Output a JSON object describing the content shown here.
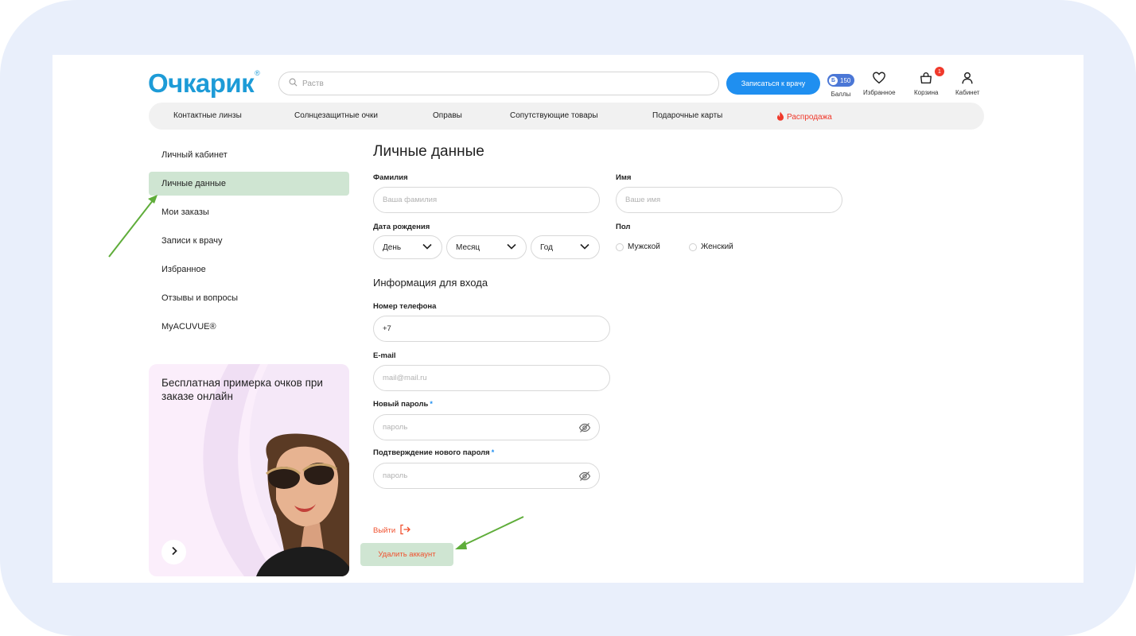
{
  "header": {
    "logo": "Очкарик",
    "logo_mark": "®",
    "search_placeholder": "Раств",
    "doctor_button": "Записаться к врачу",
    "points_value": "150",
    "points_label": "Баллы",
    "favorites_label": "Избранное",
    "cart_label": "Корзина",
    "cart_count": "1",
    "cabinet_label": "Кабинет"
  },
  "nav": {
    "items": [
      "Контактные линзы",
      "Солнцезащитные очки",
      "Оправы",
      "Сопутствующие товары",
      "Подарочные карты"
    ],
    "sale": "Распродажа",
    "sale_color": "#f0392b"
  },
  "sidebar": {
    "items": [
      "Личный кабинет",
      "Личные данные",
      "Мои заказы",
      "Записи к врачу",
      "Избранное",
      "Отзывы и вопросы",
      "MyACUVUE®"
    ],
    "active_index": 1
  },
  "promo": {
    "text": "Бесплатная примерка очков при заказе онлайн"
  },
  "form": {
    "title": "Личные данные",
    "surname_label": "Фамилия",
    "surname_placeholder": "Ваша фамилия",
    "name_label": "Имя",
    "name_placeholder": "Ваше имя",
    "birth_label": "Дата рождения",
    "day": "День",
    "month": "Месяц",
    "year": "Год",
    "gender_label": "Пол",
    "male": "Мужской",
    "female": "Женский",
    "login_section": "Информация для входа",
    "phone_label": "Номер телефона",
    "phone_value": "+7",
    "email_label": "E-mail",
    "email_placeholder": "mail@mail.ru",
    "new_password_label": "Новый пароль",
    "new_password_placeholder": "пароль",
    "confirm_password_label": "Подтверждение нового пароля",
    "confirm_password_placeholder": "пароль",
    "required_mark": "*",
    "logout": "Выйти",
    "delete_account": "Удалить аккаунт"
  },
  "colors": {
    "accent": "#1f8ff0",
    "logo": "#1d9bd7",
    "highlight": "#cfe5d2",
    "annotation_arrow": "#5fad3a",
    "danger": "#f0512f"
  }
}
